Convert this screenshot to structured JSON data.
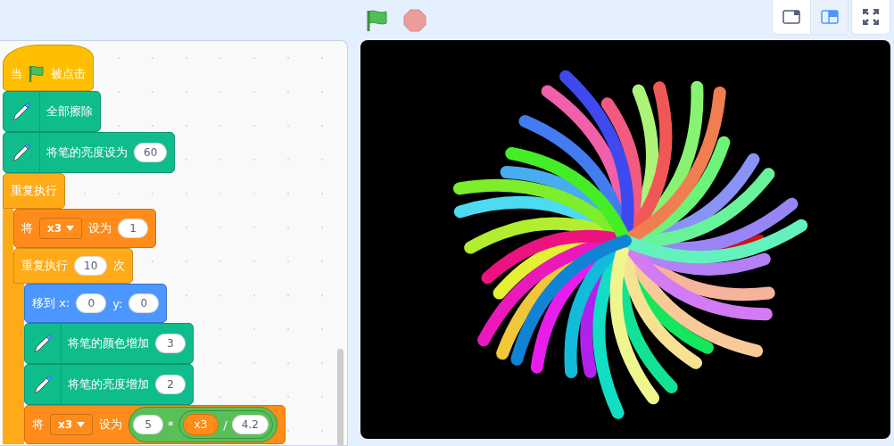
{
  "toolbar": {
    "stage_sizes": [
      {
        "kind": "small",
        "selected": false
      },
      {
        "kind": "large",
        "selected": true
      }
    ]
  },
  "script": [
    {
      "kind": "event",
      "parts": [
        {
          "kind": "text",
          "text": "当"
        },
        {
          "kind": "flag"
        },
        {
          "kind": "text",
          "text": "被点击"
        }
      ]
    },
    {
      "kind": "pen",
      "parts": [
        {
          "kind": "text",
          "text": "全部擦除"
        }
      ]
    },
    {
      "kind": "pen",
      "parts": [
        {
          "kind": "text",
          "text": "将笔的亮度设为"
        },
        {
          "kind": "input",
          "text": "60"
        }
      ]
    },
    {
      "kind": "control",
      "parts": [
        {
          "kind": "text",
          "text": "重复执行"
        }
      ],
      "children": [
        {
          "kind": "data",
          "parts": [
            {
              "kind": "text",
              "text": "将"
            },
            {
              "kind": "dropdown",
              "text": "x3"
            },
            {
              "kind": "text",
              "text": "设为"
            },
            {
              "kind": "input",
              "text": "1"
            }
          ]
        },
        {
          "kind": "control",
          "parts": [
            {
              "kind": "text",
              "text": "重复执行"
            },
            {
              "kind": "input",
              "text": "10"
            },
            {
              "kind": "text",
              "text": "次"
            }
          ],
          "children": [
            {
              "kind": "motion",
              "parts": [
                {
                  "kind": "text",
                  "text": "移到 x:"
                },
                {
                  "kind": "input",
                  "text": "0"
                },
                {
                  "kind": "text",
                  "text": "y:"
                },
                {
                  "kind": "input",
                  "text": "0"
                }
              ]
            },
            {
              "kind": "pen",
              "parts": [
                {
                  "kind": "text",
                  "text": "将笔的颜色增加"
                },
                {
                  "kind": "input",
                  "text": "3"
                }
              ]
            },
            {
              "kind": "pen",
              "parts": [
                {
                  "kind": "text",
                  "text": "将笔的亮度增加"
                },
                {
                  "kind": "input",
                  "text": "2"
                }
              ]
            },
            {
              "kind": "data",
              "parts": [
                {
                  "kind": "text",
                  "text": "将"
                },
                {
                  "kind": "dropdown",
                  "text": "x3"
                },
                {
                  "kind": "text",
                  "text": "设为"
                },
                {
                  "kind": "operator",
                  "parts": [
                    {
                      "kind": "input",
                      "text": "5"
                    },
                    {
                      "kind": "text",
                      "text": "*"
                    },
                    {
                      "kind": "operator",
                      "parts": [
                        {
                          "kind": "variable",
                          "text": "x3"
                        },
                        {
                          "kind": "text",
                          "text": "/"
                        },
                        {
                          "kind": "input",
                          "text": "4.2"
                        }
                      ]
                    }
                  ]
                }
              ]
            }
          ]
        }
      ]
    }
  ]
}
